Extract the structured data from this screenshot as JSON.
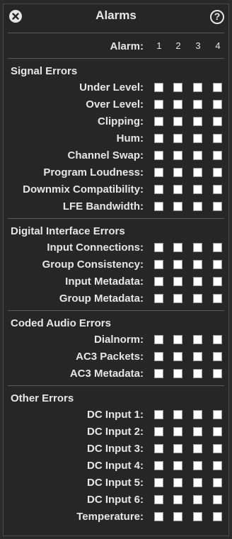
{
  "window": {
    "title": "Alarms",
    "help_glyph": "?"
  },
  "header": {
    "label": "Alarm:",
    "columns": [
      "1",
      "2",
      "3",
      "4"
    ]
  },
  "sections": [
    {
      "title": "Signal Errors",
      "rows": [
        {
          "label": "Under Level:",
          "checked": [
            false,
            false,
            false,
            false
          ]
        },
        {
          "label": "Over Level:",
          "checked": [
            false,
            false,
            false,
            false
          ]
        },
        {
          "label": "Clipping:",
          "checked": [
            false,
            false,
            false,
            false
          ]
        },
        {
          "label": "Hum:",
          "checked": [
            false,
            false,
            false,
            false
          ]
        },
        {
          "label": "Channel Swap:",
          "checked": [
            false,
            false,
            false,
            false
          ]
        },
        {
          "label": "Program Loudness:",
          "checked": [
            false,
            false,
            false,
            false
          ]
        },
        {
          "label": "Downmix Compatibility:",
          "checked": [
            false,
            false,
            false,
            false
          ]
        },
        {
          "label": "LFE Bandwidth:",
          "checked": [
            false,
            false,
            false,
            false
          ]
        }
      ]
    },
    {
      "title": "Digital Interface Errors",
      "rows": [
        {
          "label": "Input Connections:",
          "checked": [
            false,
            false,
            false,
            false
          ]
        },
        {
          "label": "Group Consistency:",
          "checked": [
            false,
            false,
            false,
            false
          ]
        },
        {
          "label": "Input Metadata:",
          "checked": [
            false,
            false,
            false,
            false
          ]
        },
        {
          "label": "Group Metadata:",
          "checked": [
            false,
            false,
            false,
            false
          ]
        }
      ]
    },
    {
      "title": "Coded Audio Errors",
      "rows": [
        {
          "label": "Dialnorm:",
          "checked": [
            false,
            false,
            false,
            false
          ]
        },
        {
          "label": "AC3 Packets:",
          "checked": [
            false,
            false,
            false,
            false
          ]
        },
        {
          "label": "AC3 Metadata:",
          "checked": [
            false,
            false,
            false,
            false
          ]
        }
      ]
    },
    {
      "title": "Other Errors",
      "rows": [
        {
          "label": "DC Input 1:",
          "checked": [
            false,
            false,
            false,
            false
          ]
        },
        {
          "label": "DC Input 2:",
          "checked": [
            false,
            false,
            false,
            false
          ]
        },
        {
          "label": "DC Input 3:",
          "checked": [
            false,
            false,
            false,
            false
          ]
        },
        {
          "label": "DC Input 4:",
          "checked": [
            false,
            false,
            false,
            false
          ]
        },
        {
          "label": "DC Input 5:",
          "checked": [
            false,
            false,
            false,
            false
          ]
        },
        {
          "label": "DC Input 6:",
          "checked": [
            false,
            false,
            false,
            false
          ]
        },
        {
          "label": "Temperature:",
          "checked": [
            false,
            false,
            false,
            false
          ]
        }
      ]
    }
  ],
  "icons": {
    "close": "close-icon",
    "help": "help-icon"
  }
}
